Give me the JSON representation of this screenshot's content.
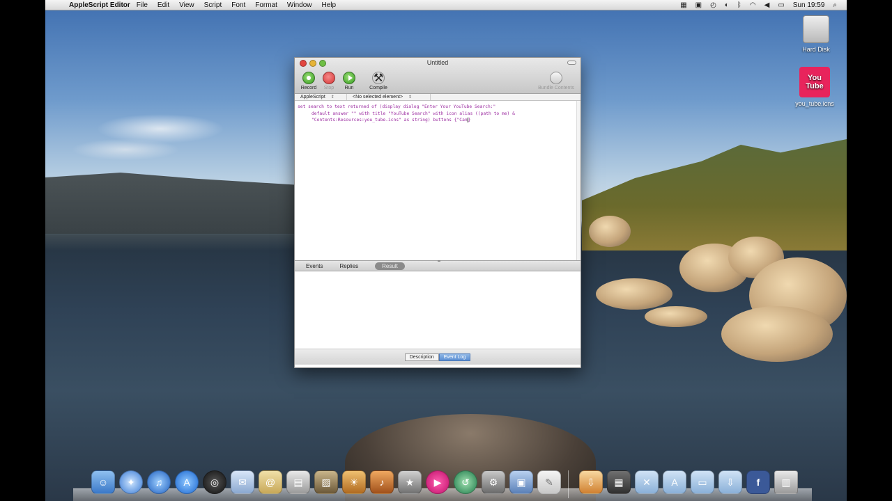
{
  "menubar": {
    "app_name": "AppleScript Editor",
    "menus": [
      "File",
      "Edit",
      "View",
      "Script",
      "Font",
      "Format",
      "Window",
      "Help"
    ],
    "clock": "Sun 19:59"
  },
  "desktop": {
    "icons": [
      {
        "label": "Hard Disk",
        "icon": "hard-disk-icon"
      },
      {
        "label": "you_tube.icns",
        "icon": "youtube-file-icon",
        "badge": "You Tube"
      }
    ]
  },
  "window": {
    "title": "Untitled",
    "toolbar": {
      "record": "Record",
      "stop": "Stop",
      "run": "Run",
      "compile": "Compile",
      "bundle": "Bundle Contents"
    },
    "navbar": {
      "language": "AppleScript",
      "element": "<No selected element>"
    },
    "editor": {
      "lines": [
        "set search to text returned of (display dialog \"Enter Your YouTube Search:\"",
        "default answer \"\" with title \"YouTube Search\" with icon alias ((path to me) &",
        "\"Contents:Resources:you_tube.icns\" as string) buttons {\"Can"
      ],
      "line_end": "}"
    },
    "log_tabs": [
      "Events",
      "Replies",
      "Result"
    ],
    "bottom_tabs": [
      "Description",
      "Event Log"
    ]
  },
  "colors": {
    "code_text": "#9b2ba0",
    "youtube_red": "#e8245c"
  }
}
